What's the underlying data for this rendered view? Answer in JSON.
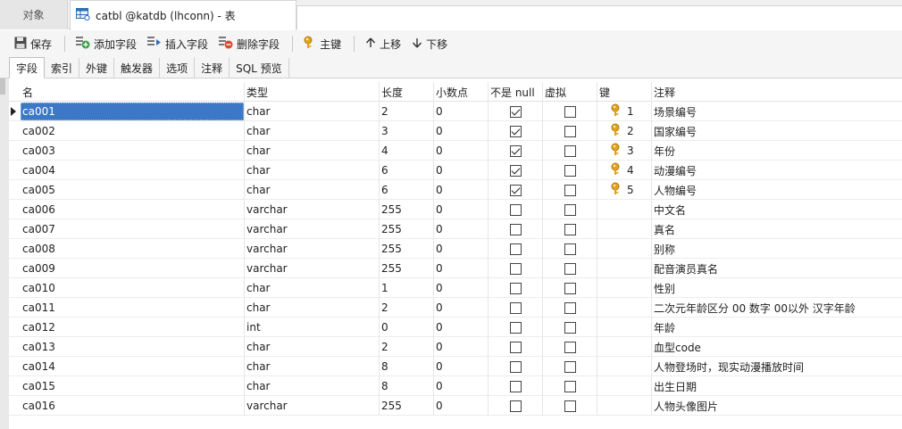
{
  "window": {
    "objects_tab": "对象",
    "active_tab_title": "catbl @katdb (lhconn) - 表"
  },
  "toolbar": {
    "save": "保存",
    "add_field": "添加字段",
    "insert_field": "插入字段",
    "delete_field": "删除字段",
    "primary_key": "主键",
    "move_up": "上移",
    "move_down": "下移"
  },
  "subtabs": [
    "字段",
    "索引",
    "外键",
    "触发器",
    "选项",
    "注释",
    "SQL 预览"
  ],
  "columns": {
    "name": "名",
    "type": "类型",
    "length": "长度",
    "decimals": "小数点",
    "not_null": "不是 null",
    "virtual": "虚拟",
    "key": "键",
    "comment": "注释"
  },
  "rows": [
    {
      "name": "ca001",
      "type": "char",
      "length": "2",
      "decimals": "0",
      "not_null": true,
      "virtual": false,
      "key": "1",
      "comment": "场景编号"
    },
    {
      "name": "ca002",
      "type": "char",
      "length": "3",
      "decimals": "0",
      "not_null": true,
      "virtual": false,
      "key": "2",
      "comment": "国家编号"
    },
    {
      "name": "ca003",
      "type": "char",
      "length": "4",
      "decimals": "0",
      "not_null": true,
      "virtual": false,
      "key": "3",
      "comment": "年份"
    },
    {
      "name": "ca004",
      "type": "char",
      "length": "6",
      "decimals": "0",
      "not_null": true,
      "virtual": false,
      "key": "4",
      "comment": "动漫编号"
    },
    {
      "name": "ca005",
      "type": "char",
      "length": "6",
      "decimals": "0",
      "not_null": true,
      "virtual": false,
      "key": "5",
      "comment": "人物编号"
    },
    {
      "name": "ca006",
      "type": "varchar",
      "length": "255",
      "decimals": "0",
      "not_null": false,
      "virtual": false,
      "key": "",
      "comment": "中文名"
    },
    {
      "name": "ca007",
      "type": "varchar",
      "length": "255",
      "decimals": "0",
      "not_null": false,
      "virtual": false,
      "key": "",
      "comment": "真名"
    },
    {
      "name": "ca008",
      "type": "varchar",
      "length": "255",
      "decimals": "0",
      "not_null": false,
      "virtual": false,
      "key": "",
      "comment": "别称"
    },
    {
      "name": "ca009",
      "type": "varchar",
      "length": "255",
      "decimals": "0",
      "not_null": false,
      "virtual": false,
      "key": "",
      "comment": "配音演员真名"
    },
    {
      "name": "ca010",
      "type": "char",
      "length": "1",
      "decimals": "0",
      "not_null": false,
      "virtual": false,
      "key": "",
      "comment": "性别"
    },
    {
      "name": "ca011",
      "type": "char",
      "length": "2",
      "decimals": "0",
      "not_null": false,
      "virtual": false,
      "key": "",
      "comment": "二次元年龄区分 00 数字 00以外 汉字年龄"
    },
    {
      "name": "ca012",
      "type": "int",
      "length": "0",
      "decimals": "0",
      "not_null": false,
      "virtual": false,
      "key": "",
      "comment": "年龄"
    },
    {
      "name": "ca013",
      "type": "char",
      "length": "2",
      "decimals": "0",
      "not_null": false,
      "virtual": false,
      "key": "",
      "comment": "血型code"
    },
    {
      "name": "ca014",
      "type": "char",
      "length": "8",
      "decimals": "0",
      "not_null": false,
      "virtual": false,
      "key": "",
      "comment": "人物登场时，现实动漫播放时间"
    },
    {
      "name": "ca015",
      "type": "char",
      "length": "8",
      "decimals": "0",
      "not_null": false,
      "virtual": false,
      "key": "",
      "comment": "出生日期"
    },
    {
      "name": "ca016",
      "type": "varchar",
      "length": "255",
      "decimals": "0",
      "not_null": false,
      "virtual": false,
      "key": "",
      "comment": "人物头像图片"
    }
  ],
  "icons": {
    "table": "table-icon",
    "save": "save-icon",
    "add": "add-field-icon",
    "insert": "insert-field-icon",
    "delete": "delete-field-icon",
    "key": "key-icon",
    "up": "arrow-up-icon",
    "down": "arrow-down-icon"
  },
  "colors": {
    "selection": "#3d78c8",
    "key_gold": "#e2a21b",
    "add_green": "#3aa04a",
    "delete_red": "#d94a2c"
  }
}
